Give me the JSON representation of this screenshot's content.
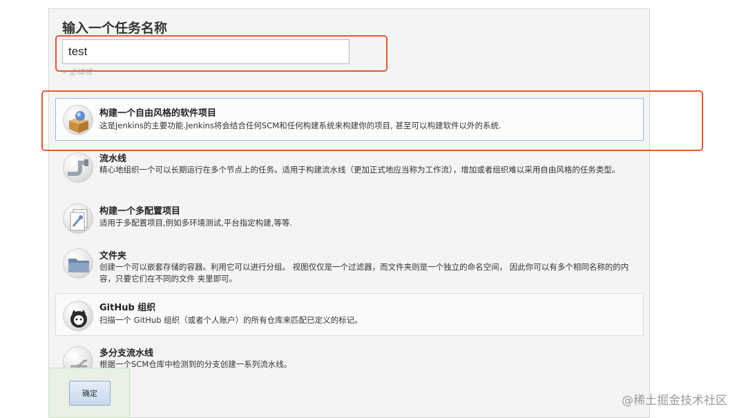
{
  "form": {
    "heading": "输入一个任务名称",
    "name_value": "test",
    "required_hint": "» 必填项"
  },
  "items": [
    {
      "title": "构建一个自由风格的软件项目",
      "desc": "这是Jenkins的主要功能.Jenkins将会结合任何SCM和任何构建系统来构建你的项目, 甚至可以构建软件以外的系统.",
      "icon": "freestyle-project-icon",
      "selected": true
    },
    {
      "title": "流水线",
      "desc": "精心地组织一个可以长期运行在多个节点上的任务。适用于构建流水线（更加正式地应当称为工作流），增加或者组织难以采用自由风格的任务类型。",
      "icon": "pipeline-icon"
    },
    {
      "title": "构建一个多配置项目",
      "desc": "适用于多配置项目,例如多环境测试,平台指定构建,等等.",
      "icon": "multi-config-icon"
    },
    {
      "title": "文件夹",
      "desc": "创建一个可以嵌套存储的容器。利用它可以进行分组。 视图仅仅是一个过滤器，而文件夹则是一个独立的命名空间， 因此你可以有多个相同名称的的内容，只要它们在不同的文件 夹里即可。",
      "icon": "folder-icon"
    },
    {
      "title": "GitHub 组织",
      "desc": "扫描一个 GitHub 组织（或者个人账户）的所有仓库来匹配已定义的标记。",
      "icon": "github-org-icon"
    },
    {
      "title": "多分支流水线",
      "desc": "根据一个SCM仓库中检测到的分支创建一系列流水线。",
      "icon": "multibranch-pipeline-icon"
    }
  ],
  "footer": {
    "ok_label": "确定"
  },
  "watermark": "@稀土掘金技术社区",
  "colors": {
    "highlight": "#e9542f",
    "selected_border": "#97b6df"
  }
}
